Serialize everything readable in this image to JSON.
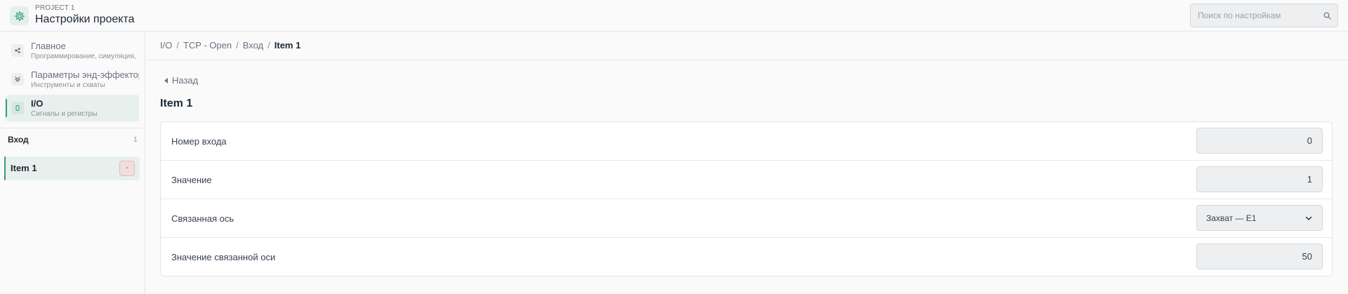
{
  "header": {
    "project_label": "PROJECT 1",
    "title": "Настройки проекта",
    "search_placeholder": "Поиск по настройкам"
  },
  "sidebar": {
    "items": [
      {
        "label": "Главное",
        "subtitle": "Программирование, симуляция,",
        "icon": "share-nodes-icon"
      },
      {
        "label": "Параметры энд-эффекторов",
        "subtitle": "Инструменты и схваты",
        "icon": "gripper-icon"
      },
      {
        "label": "I/O",
        "subtitle": "Сигналы и регистры",
        "icon": "io-port-icon",
        "active": true
      }
    ],
    "section": {
      "title": "Вход",
      "count": "1",
      "items": [
        {
          "label": "Item 1",
          "remove_label": "-"
        }
      ]
    }
  },
  "breadcrumb": [
    "I/O",
    "TCP - Open",
    "Вход",
    "Item 1"
  ],
  "breadcrumb_separator": "/",
  "main": {
    "back_label": "Назад",
    "title": "Item 1",
    "fields": [
      {
        "label": "Номер входа",
        "value": "0"
      },
      {
        "label": "Значение",
        "value": "1"
      },
      {
        "label": "Связанная ось",
        "value": "Захват — E1",
        "type": "select"
      },
      {
        "label": "Значение связанной оси",
        "value": "50"
      }
    ]
  },
  "colors": {
    "accent": "#2f9e77",
    "accent_bg": "#e7f0ed",
    "danger_bg": "#f1dede"
  }
}
